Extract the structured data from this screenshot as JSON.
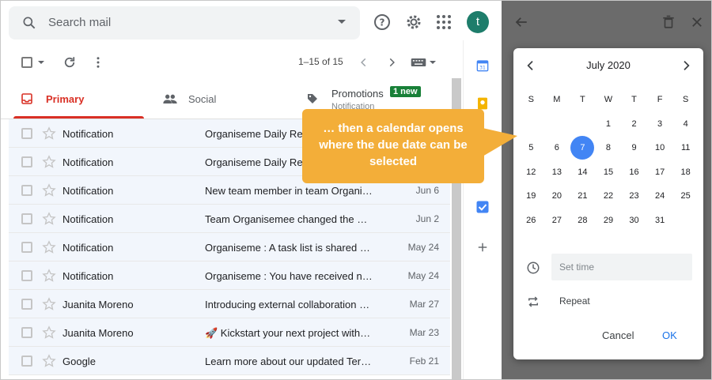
{
  "header": {
    "search_placeholder": "Search mail",
    "avatar_letter": "t"
  },
  "toolbar": {
    "pagination": "1–15 of 15"
  },
  "tabs": [
    {
      "label": "Primary",
      "active": true
    },
    {
      "label": "Social",
      "active": false
    },
    {
      "label": "Promotions",
      "badge": "1 new",
      "sub": "Notification"
    }
  ],
  "emails": [
    {
      "sender": "Notification",
      "subject": "Organiseme Daily Rep",
      "date": ""
    },
    {
      "sender": "Notification",
      "subject": "Organiseme Daily Rep",
      "date": ""
    },
    {
      "sender": "Notification",
      "subject": "New team member in team Organis…",
      "date": "Jun 6"
    },
    {
      "sender": "Notification",
      "subject": "Team Organisemee changed the na…",
      "date": "Jun 2"
    },
    {
      "sender": "Notification",
      "subject": "Organiseme : A task list is shared b…",
      "date": "May 24"
    },
    {
      "sender": "Notification",
      "subject": "Organiseme : You have received ne…",
      "date": "May 24"
    },
    {
      "sender": "Juanita Moreno",
      "subject": "Introducing external collaboration …",
      "date": "Mar 27"
    },
    {
      "sender": "Juanita Moreno",
      "subject": "🚀 Kickstart your next project with …",
      "date": "Mar 23"
    },
    {
      "sender": "Google",
      "subject": "Learn more about our updated Ter…",
      "date": "Feb 21"
    }
  ],
  "callout": {
    "text": "… then a calendar opens where the due date can be selected",
    "color": "#f3ae39"
  },
  "calendar": {
    "month": "July 2020",
    "weekdays": [
      "S",
      "M",
      "T",
      "W",
      "T",
      "F",
      "S"
    ],
    "weeks": [
      [
        "",
        "",
        "",
        "1",
        "2",
        "3",
        "4"
      ],
      [
        "5",
        "6",
        "7",
        "8",
        "9",
        "10",
        "11"
      ],
      [
        "12",
        "13",
        "14",
        "15",
        "16",
        "17",
        "18"
      ],
      [
        "19",
        "20",
        "21",
        "22",
        "23",
        "24",
        "25"
      ],
      [
        "26",
        "27",
        "28",
        "29",
        "30",
        "31",
        ""
      ]
    ],
    "selected": "7",
    "set_time_placeholder": "Set time",
    "repeat_label": "Repeat",
    "cancel_label": "Cancel",
    "ok_label": "OK",
    "accent": "#4285f4"
  }
}
